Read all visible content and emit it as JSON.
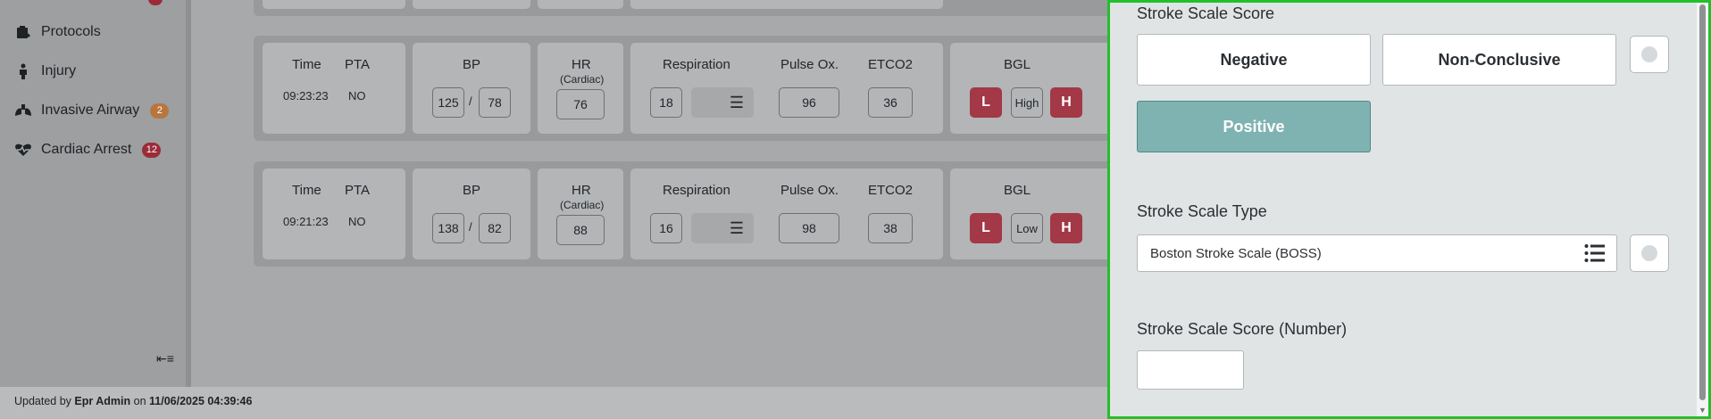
{
  "sidebar": {
    "items": [
      {
        "label": "Protocols",
        "icon": "protocols-icon",
        "badge": ""
      },
      {
        "label": "Injury",
        "icon": "injury-icon",
        "badge": ""
      },
      {
        "label": "Invasive Airway",
        "icon": "lungs-icon",
        "badge": "2"
      },
      {
        "label": "Cardiac Arrest",
        "icon": "heart-pulse-icon",
        "badge": "12"
      }
    ],
    "collapse_icon": "collapse-sidebar-icon"
  },
  "footer": {
    "prefix": "Updated by",
    "user": "Epr Admin",
    "on": "on",
    "datetime": "11/06/2025 04:39:46"
  },
  "vitals": {
    "headers": {
      "time": "Time",
      "pta": "PTA",
      "bp": "BP",
      "hr": "HR",
      "hr_sub": "(Cardiac)",
      "respiration": "Respiration",
      "pulse_ox": "Pulse Ox.",
      "etco2": "ETCO2",
      "bgl": "BGL"
    },
    "bp_separator": "/",
    "bgl_low_btn": "L",
    "bgl_high_btn": "H",
    "rows": [
      {
        "time": "09:23:23",
        "pta": "NO",
        "bp_sys": "125",
        "bp_dia": "78",
        "hr": "76",
        "resp": "18",
        "pulse_ox": "96",
        "etco2": "36",
        "bgl": "High"
      },
      {
        "time": "09:21:23",
        "pta": "NO",
        "bp_sys": "138",
        "bp_dia": "82",
        "hr": "88",
        "resp": "16",
        "pulse_ox": "98",
        "etco2": "38",
        "bgl": "Low"
      }
    ]
  },
  "panel": {
    "score_label": "Stroke Scale Score",
    "options": {
      "negative": "Negative",
      "non_conclusive": "Non-Conclusive",
      "positive": "Positive"
    },
    "selected_option": "Positive",
    "type_label": "Stroke Scale Type",
    "type_value": "Boston Stroke Scale (BOSS)",
    "number_label": "Stroke Scale Score (Number)",
    "number_value": "",
    "accent_color": "#7fb3b1",
    "highlight_border_color": "#22c02a"
  }
}
